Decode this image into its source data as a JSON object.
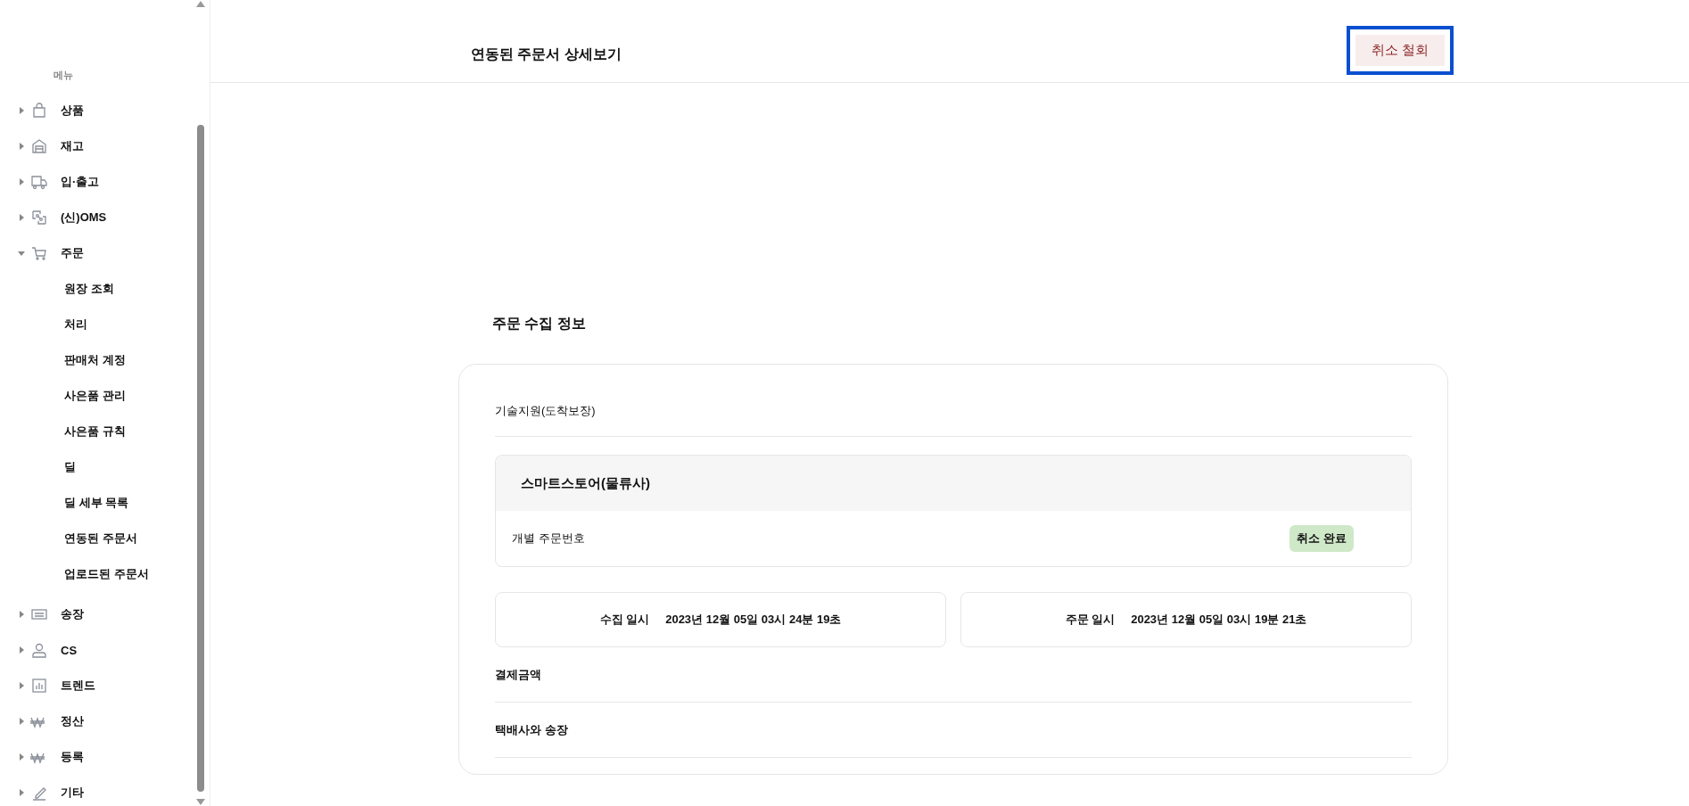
{
  "sidebar": {
    "heading": "메뉴",
    "items": [
      {
        "label": "상품",
        "expanded": false
      },
      {
        "label": "재고",
        "expanded": false
      },
      {
        "label": "입·출고",
        "expanded": false
      },
      {
        "label": "(신)OMS",
        "expanded": false
      },
      {
        "label": "주문",
        "expanded": true,
        "children": [
          {
            "label": "원장 조회"
          },
          {
            "label": "처리"
          },
          {
            "label": "판매처 계정"
          },
          {
            "label": "사은품 관리"
          },
          {
            "label": "사은품 규칙"
          },
          {
            "label": "딜"
          },
          {
            "label": "딜 세부 목록"
          },
          {
            "label": "연동된 주문서"
          },
          {
            "label": "업로드된 주문서"
          }
        ]
      },
      {
        "label": "송장",
        "expanded": false
      },
      {
        "label": "CS",
        "expanded": false
      },
      {
        "label": "트렌드",
        "expanded": false
      },
      {
        "label": "정산",
        "expanded": false
      },
      {
        "label": "등록",
        "expanded": false
      },
      {
        "label": "기타",
        "expanded": false
      }
    ]
  },
  "header": {
    "title": "연동된 주문서 상세보기",
    "action": {
      "label": "취소 철회",
      "focused": true
    }
  },
  "section": {
    "title": "주문 수집 정보",
    "card": {
      "category": "기술지원(도착보장)",
      "store": {
        "name": "스마트스토어(물류사)",
        "row_label": "개별 주문번호",
        "status": "취소 완료"
      },
      "dates": [
        {
          "label": "수집 일시",
          "value": "2023년 12월 05일 03시 24분 19초"
        },
        {
          "label": "주문 일시",
          "value": "2023년 12월 05일 03시 19분 21초"
        }
      ],
      "rows": [
        {
          "label": "결제금액"
        },
        {
          "label": "택배사와 송장"
        }
      ]
    }
  }
}
